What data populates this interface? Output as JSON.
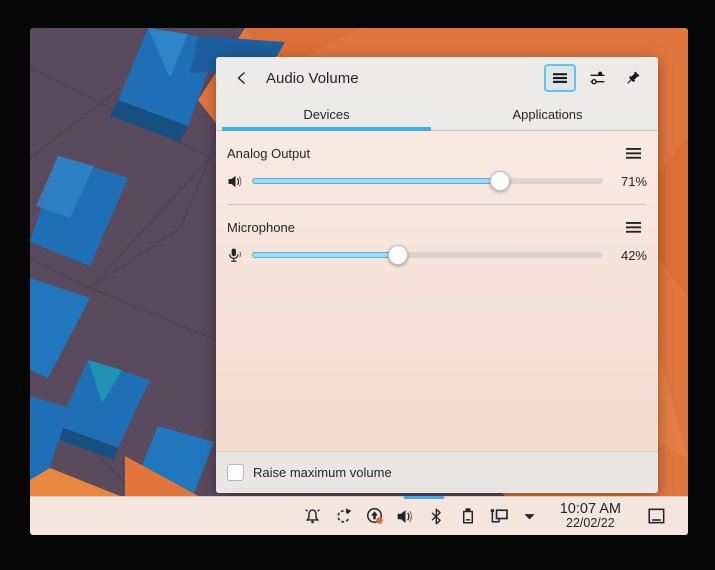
{
  "popup": {
    "title": "Audio Volume",
    "header_icons": [
      "back-icon",
      "hamburger-menu-icon",
      "mixer-settings-icon",
      "pin-icon"
    ],
    "tabs": [
      {
        "label": "Devices",
        "active": true
      },
      {
        "label": "Applications",
        "active": false
      }
    ],
    "devices": [
      {
        "name": "Analog Output",
        "icon": "speaker-icon",
        "volume_percent": 71,
        "volume_label": "71%"
      },
      {
        "name": "Microphone",
        "icon": "microphone-icon",
        "volume_percent": 42,
        "volume_label": "42%"
      }
    ],
    "footer": {
      "checkbox_label": "Raise maximum volume",
      "checked": false
    }
  },
  "taskbar": {
    "tray_icons": [
      "notifications-bell-icon",
      "device-sync-icon",
      "software-updates-icon",
      "audio-volume-icon",
      "bluetooth-icon",
      "clipboard-icon",
      "network-wired-icon",
      "expand-tray-chevron-icon"
    ],
    "clock": {
      "time": "10:07 AM",
      "date": "22/02/22"
    },
    "show_desktop_icon": "show-desktop-icon"
  },
  "colors": {
    "accent": "#3daee9",
    "slider_fill": "#a6d8f2",
    "slider_border": "#4cb2e7",
    "update_badge": "#e2653f",
    "wallpaper_purple": "#5a4a5e",
    "wallpaper_orange": "#e0753e",
    "wallpaper_blue": "#1e6fb5"
  }
}
